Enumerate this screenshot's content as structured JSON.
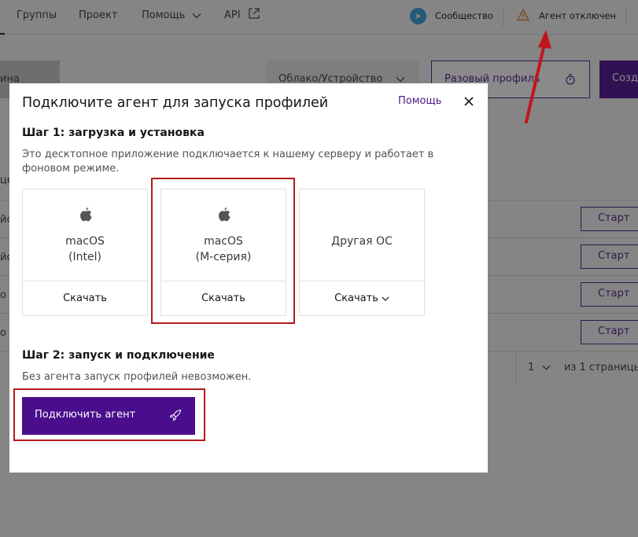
{
  "nav": {
    "groups": "Группы",
    "project": "Проект",
    "help": "Помощь",
    "api": "API",
    "community": "Сообщество",
    "agent_status": "Агент отключен"
  },
  "toolbar": {
    "fragment_left": "ина",
    "cloud_select": "Облако/Устройство",
    "one_time_profile": "Разовый профиль",
    "create": "Созд"
  },
  "table": {
    "row_fragments": [
      "цe",
      "йст",
      "йст",
      "о",
      "о"
    ],
    "start_label": "Старт",
    "page_number": "1",
    "page_of": "из 1 страницы"
  },
  "modal": {
    "title": "Подключите агент для запуска профилей",
    "help_link": "Помощь",
    "step1_title": "Шаг 1: загрузка и установка",
    "step1_desc": "Это десктопное приложение подключается к нашему серверу и работает в фоновом режиме.",
    "os_options": [
      {
        "name_line1": "macOS",
        "name_line2": "(Intel)",
        "download": "Скачать"
      },
      {
        "name_line1": "macOS",
        "name_line2": "(M-серия)",
        "download": "Скачать"
      },
      {
        "name_line1": "Другая ОС",
        "name_line2": "",
        "download": "Скачать"
      }
    ],
    "step2_title": "Шаг 2: запуск и подключение",
    "step2_desc": "Без агента запуск профилей невозможен.",
    "connect_button": "Подключить агент"
  },
  "colors": {
    "brand_purple": "#4a0d8c",
    "annotation_red": "#b31b1b"
  }
}
